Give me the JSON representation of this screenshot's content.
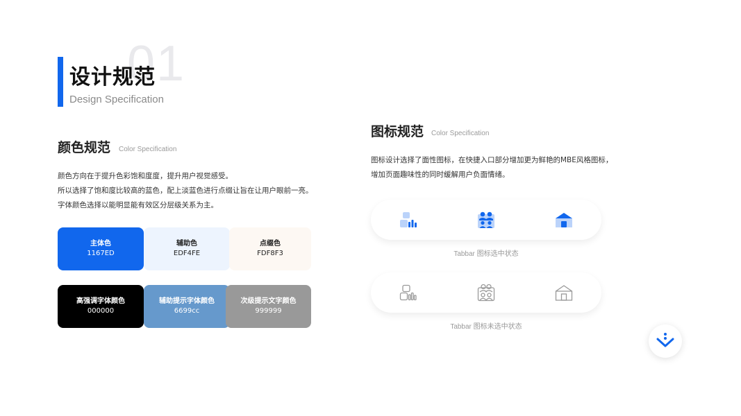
{
  "header": {
    "number": "01",
    "title": "设计规范",
    "subtitle": "Design Specification"
  },
  "color_section": {
    "title": "颜色规范",
    "subtitle": "Color Specification",
    "lines": [
      "颜色方向在于提升色彩饱和度度，提升用户视觉感受。",
      "所以选择了饱和度比较高的蓝色，配上淡蓝色进行点缀让旨在让用户眼前一亮。",
      "字体颜色选择以能明显能有效区分层级关系为主。"
    ],
    "swatches": [
      {
        "name": "主体色",
        "code": "1167ED",
        "color": "#1167ED",
        "text_color": "#ffffff"
      },
      {
        "name": "辅助色",
        "code": "EDF4FE",
        "color": "#EDF4FE",
        "text_color": "#222222"
      },
      {
        "name": "点缀色",
        "code": "FDF8F3",
        "color": "#FDF8F3",
        "text_color": "#222222"
      },
      {
        "name": "高强调字体颜色",
        "code": "000000",
        "color": "#000000",
        "text_color": "#ffffff"
      },
      {
        "name": "辅助提示字体颜色",
        "code": "6699cc",
        "color": "#6699cc",
        "text_color": "#ffffff"
      },
      {
        "name": "次级提示文字颜色",
        "code": "999999",
        "color": "#999999",
        "text_color": "#ffffff"
      }
    ]
  },
  "icon_section": {
    "title": "图标规范",
    "subtitle": "Color Specification",
    "lines": [
      "图标设计选择了面性图标，在快捷入口部分增加更为鲜艳的MBE风格图标，",
      "增加页面趣味性的同时缓解用户负面情绪。"
    ],
    "selected_caption": "Tabbar 图标选中状态",
    "unselected_caption": "Tabbar 图标未选中状态",
    "icons": [
      "data-chart-icon",
      "users-icon",
      "home-icon"
    ]
  },
  "colors": {
    "primary": "#1167ED",
    "light": "#BBD3FA",
    "inactive": "#999999"
  },
  "scroll_button": {
    "icon": "chevron-down-icon"
  }
}
